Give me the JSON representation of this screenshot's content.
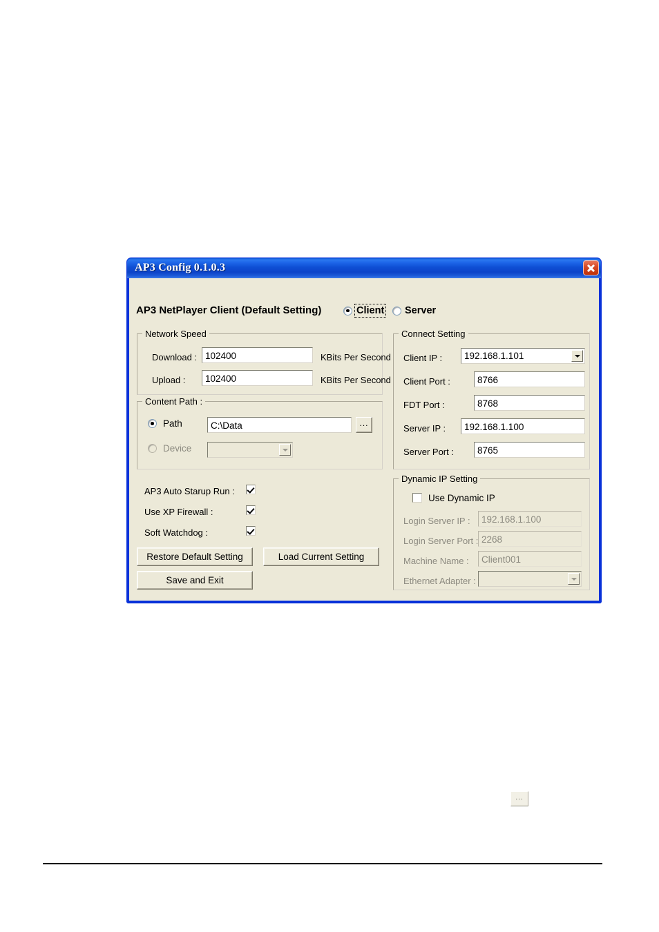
{
  "window": {
    "title": "AP3 Config 0.1.0.3",
    "close_icon": "close-icon"
  },
  "header": {
    "title": "AP3 NetPlayer Client (Default Setting)",
    "mode_options": [
      {
        "label": "Client",
        "selected": true,
        "focused": true
      },
      {
        "label": "Server",
        "selected": false,
        "focused": false
      }
    ]
  },
  "network_speed": {
    "legend": "Network Speed",
    "download_label": "Download :",
    "download_value": "102400",
    "download_unit": "KBits Per Second",
    "upload_label": "Upload :",
    "upload_value": "102400",
    "upload_unit": "KBits Per Second"
  },
  "content_path": {
    "legend": "Content Path :",
    "path_radio_label": "Path",
    "path_radio_selected": true,
    "path_value": "C:\\Data",
    "browse_label": "...",
    "device_radio_label": "Device",
    "device_radio_selected": false,
    "device_value": "",
    "device_disabled": true
  },
  "connect_setting": {
    "legend": "Connect Setting",
    "fields": [
      {
        "label": "Client IP :",
        "value": "192.168.1.101",
        "type": "combo"
      },
      {
        "label": "Client Port :",
        "value": "8766",
        "type": "text"
      },
      {
        "label": "FDT Port :",
        "value": "8768",
        "type": "text"
      },
      {
        "label": "Server IP :",
        "value": "192.168.1.100",
        "type": "text"
      },
      {
        "label": "Server Port :",
        "value": "8765",
        "type": "text"
      }
    ]
  },
  "options": {
    "checkboxes": [
      {
        "label": "AP3 Auto Starup Run :",
        "checked": true
      },
      {
        "label": "Use XP Firewall :",
        "checked": true
      },
      {
        "label": "Soft Watchdog :",
        "checked": true
      }
    ]
  },
  "buttons": {
    "restore_default": "Restore Default Setting",
    "load_current": "Load Current Setting",
    "save_and_exit": "Save and Exit"
  },
  "dynamic_ip": {
    "legend": "Dynamic IP Setting",
    "use_dynamic_label": "Use Dynamic IP",
    "use_dynamic_checked": false,
    "fields": [
      {
        "label": "Login Server IP :",
        "value": "192.168.1.100",
        "type": "text",
        "disabled": true
      },
      {
        "label": "Login Server Port :",
        "value": "2268",
        "type": "text",
        "disabled": true
      },
      {
        "label": "Machine Name :",
        "value": "Client001",
        "type": "text",
        "disabled": true
      },
      {
        "label": "Ethernet Adapter :",
        "value": "",
        "type": "combo",
        "disabled": true
      }
    ]
  },
  "page_artifacts": {
    "stray_browse_label": "...",
    "footer_rule": true
  },
  "colors": {
    "titlebar_blue": "#0831d9",
    "dialog_face": "#ece9d8",
    "close_red": "#d84c28",
    "field_white": "#ffffff",
    "disabled_text": "#8c8a80"
  }
}
